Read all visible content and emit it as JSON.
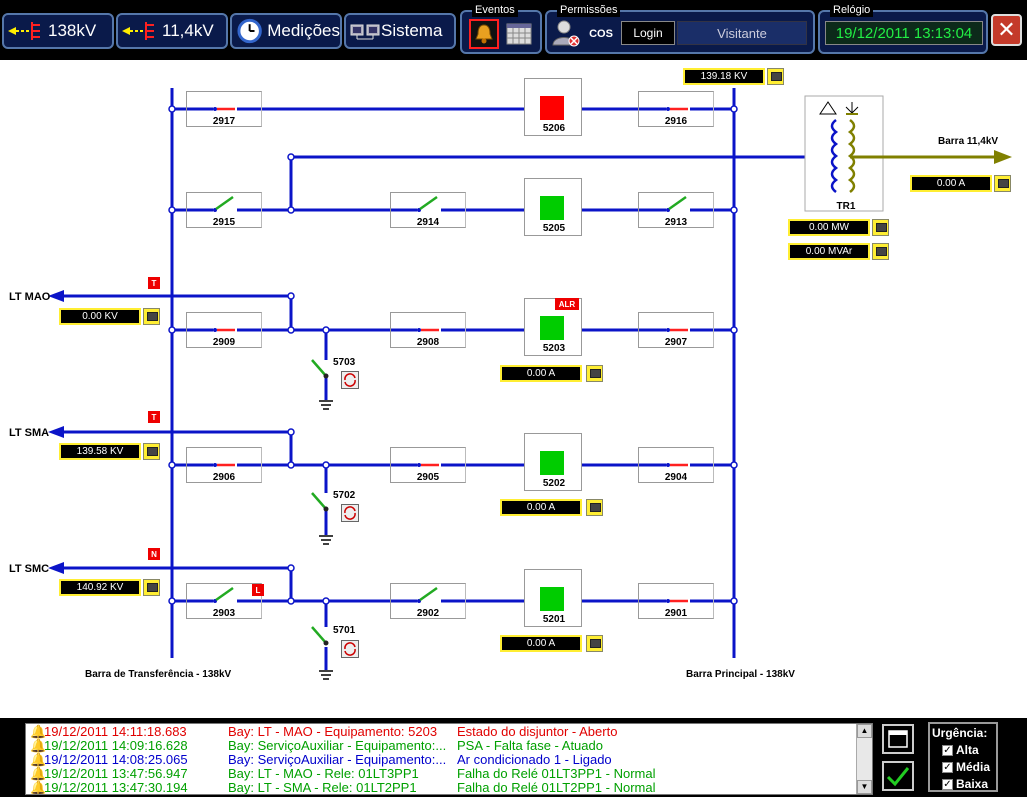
{
  "toolbar": {
    "nav_138": "138kV",
    "nav_114": "11,4kV",
    "nav_med": "Medições",
    "nav_sis": "Sistema",
    "eventos_title": "Eventos",
    "permissoes_title": "Permissões",
    "cos": "COS",
    "login": "Login",
    "user": "Visitante",
    "relogio_title": "Relógio",
    "clock": "19/12/2011 13:13:04",
    "close": "✕"
  },
  "diagram": {
    "top_voltage": "139.18 KV",
    "barra_114": "Barra 11,4kV",
    "tr1_current": "0.00 A",
    "tr1_label": "TR1",
    "tr1_mw": "0.00 MW",
    "tr1_mvar": "0.00 MVAr",
    "bus_transfer": "Barra de Transferência - 138kV",
    "bus_main": "Barra Principal - 138kV",
    "lines": [
      {
        "name": "LT MAO",
        "voltage": "0.00 KV",
        "badge": "T"
      },
      {
        "name": "LT SMA",
        "voltage": "139.58 KV",
        "badge": "T"
      },
      {
        "name": "LT SMC",
        "voltage": "140.92 KV",
        "badge": "N"
      }
    ],
    "bays": {
      "b2917": "2917",
      "b2916": "2916",
      "b2915": "2915",
      "b2914": "2914",
      "b2913": "2913",
      "b2909": "2909",
      "b2908": "2908",
      "b2907": "2907",
      "b2906": "2906",
      "b2905": "2905",
      "b2904": "2904",
      "b2903": "2903",
      "b2902": "2902",
      "b2901": "2901"
    },
    "breakers": {
      "k5206": "5206",
      "k5205": "5205",
      "k5203": "5203",
      "k5202": "5202",
      "k5201": "5201"
    },
    "breaker_colors": {
      "open": "#ff0000",
      "closed": "#00cc00"
    },
    "alarm_badge": "ALR",
    "local_badge": "L",
    "currents": {
      "c5203": "0.00 A",
      "c5202": "0.00 A",
      "c5201": "0.00 A"
    },
    "ground_switches": {
      "g5703": "5703",
      "g5702": "5702",
      "g5701": "5701"
    }
  },
  "events": [
    {
      "time": "19/12/2011 14:11:18.683",
      "bay": "Bay: LT - MAO - Equipamento: 5203",
      "msg": "Estado do disjuntor - Aberto",
      "color": "#e00000",
      "icon": "bell-red"
    },
    {
      "time": "19/12/2011 14:09:16.628",
      "bay": "Bay: ServiçoAuxiliar - Equipamento:...",
      "msg": "PSA - Falta fase - Atuado",
      "color": "#00a000",
      "icon": "bell-red"
    },
    {
      "time": "19/12/2011 14:08:25.065",
      "bay": "Bay: ServiçoAuxiliar - Equipamento:...",
      "msg": "Ar condicionado 1 - Ligado",
      "color": "#0000cc",
      "icon": "bell-red"
    },
    {
      "time": "19/12/2011 13:47:56.947",
      "bay": "Bay: LT - MAO - Rele: 01LT3PP1",
      "msg": "Falha do Relé 01LT3PP1 - Normal",
      "color": "#00a000",
      "icon": "bell-yellow"
    },
    {
      "time": "19/12/2011 13:47:30.194",
      "bay": "Bay: LT - SMA - Rele: 01LT2PP1",
      "msg": "Falha do Relé 01LT2PP1 - Normal",
      "color": "#00a000",
      "icon": "bell-yellow"
    }
  ],
  "urgency": {
    "title": "Urgência:",
    "alta": "Alta",
    "media": "Média",
    "baixa": "Baixa"
  }
}
